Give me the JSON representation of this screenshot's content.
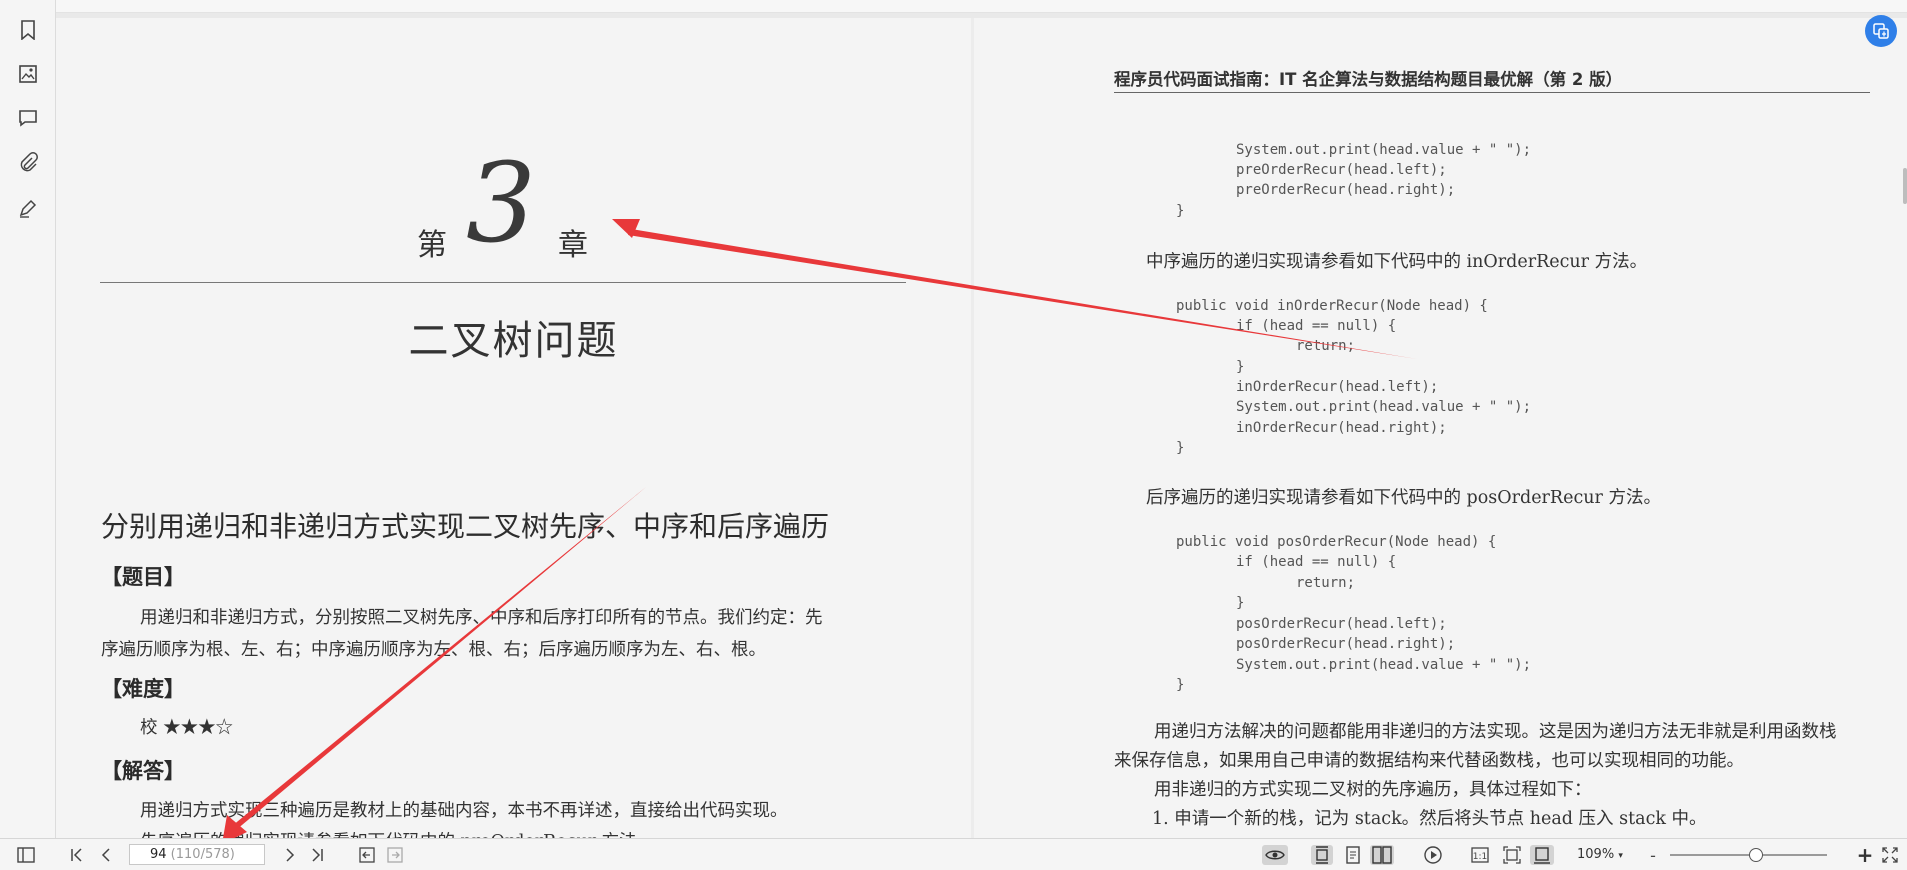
{
  "sidebar": {
    "icons": [
      "bookmark-icon",
      "thumbnail-icon",
      "comment-icon",
      "attachment-icon",
      "signature-icon"
    ]
  },
  "left_page": {
    "chapter_prefix": "第",
    "chapter_number": "3",
    "chapter_suffix": "章",
    "chapter_title": "二叉树问题",
    "section_title": "分别用递归和非递归方式实现二叉树先序、中序和后序遍历",
    "label_problem": "【题目】",
    "problem_line1": "用递归和非递归方式，分别按照二叉树先序、中序和后序打印所有的节点。我们约定：先",
    "problem_line2": "序遍历顺序为根、左、右；中序遍历顺序为左、根、右；后序遍历顺序为左、右、根。",
    "label_difficulty": "【难度】",
    "difficulty": "校 ★★★☆",
    "label_answer": "【解答】",
    "answer_line1": "用递归方式实现三种遍历是教材上的基础内容，本书不再详述，直接给出代码实现。",
    "answer_line2": "先序遍历的递归实现请参看如下代码中的 preOrderRecur 方法。"
  },
  "right_page": {
    "header": "程序员代码面试指南：IT 名企算法与数据结构题目最优解（第 2 版）",
    "code1": [
      "System.out.print(head.value + \" \");",
      "preOrderRecur(head.left);",
      "preOrderRecur(head.right);",
      "}"
    ],
    "text_inorder": "中序遍历的递归实现请参看如下代码中的 inOrderRecur 方法。",
    "code2": [
      "public void inOrderRecur(Node head) {",
      "if (head == null) {",
      "return;",
      "}",
      "inOrderRecur(head.left);",
      "System.out.print(head.value + \" \");",
      "inOrderRecur(head.right);",
      "}"
    ],
    "text_posorder": "后序遍历的递归实现请参看如下代码中的 posOrderRecur 方法。",
    "code3": [
      "public void posOrderRecur(Node head) {",
      "if (head == null) {",
      "return;",
      "}",
      "posOrderRecur(head.left);",
      "posOrderRecur(head.right);",
      "System.out.print(head.value + \" \");",
      "}"
    ],
    "para1_line1": "用递归方法解决的问题都能用非递归的方法实现。这是因为递归方法无非就是利用函数栈",
    "para1_line2": "来保存信息，如果用自己申请的数据结构来代替函数栈，也可以实现相同的功能。",
    "para2": "用非递归的方式实现二叉树的先序遍历，具体过程如下：",
    "step1": "1.  申请一个新的栈，记为 stack。然后将头节点 head 压入 stack 中。"
  },
  "statusbar": {
    "page_current": "94",
    "page_total": " (110/578)",
    "zoom": "109%",
    "zoom_minus": "-",
    "zoom_plus": "+"
  },
  "colors": {
    "annotation_arrow": "#e8383a",
    "accent": "#2f7fe8"
  }
}
